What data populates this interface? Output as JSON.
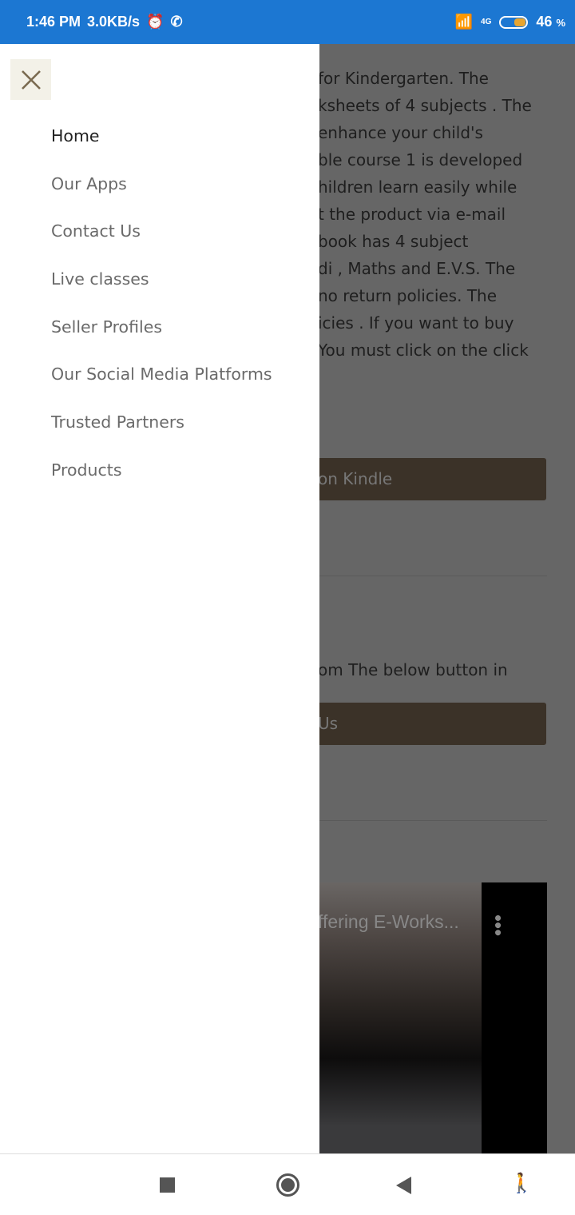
{
  "status_bar": {
    "time": "1:46 PM",
    "speed": "3.0KB/s",
    "network": "4G",
    "battery": "46",
    "battery_unit": "%"
  },
  "background": {
    "text_lines": [
      "for Kindergarten. The",
      "ksheets of 4 subjects . The",
      "enhance your child's",
      "ble course 1 is developed",
      "hildren learn easily while",
      "t the product via e-mail",
      "book has 4 subject",
      "di , Maths and E.V.S. The",
      "no return policies. The",
      "icies . If you want to buy",
      "You must click on the click"
    ],
    "kindle_button": "on Kindle",
    "text2": "om The below button in",
    "contact_button": "Us",
    "video_title": "ffering E-Works..."
  },
  "drawer": {
    "items": [
      {
        "label": "Home",
        "active": true
      },
      {
        "label": "Our Apps"
      },
      {
        "label": "Contact Us"
      },
      {
        "label": "Live classes"
      },
      {
        "label": "Seller Profiles"
      },
      {
        "label": "Our Social Media Platforms"
      },
      {
        "label": "Trusted Partners"
      },
      {
        "label": "Products"
      }
    ]
  },
  "colors": {
    "status_bar": "#1c77d2",
    "close_icon": "#7a6a50",
    "button": "#3b3228"
  }
}
